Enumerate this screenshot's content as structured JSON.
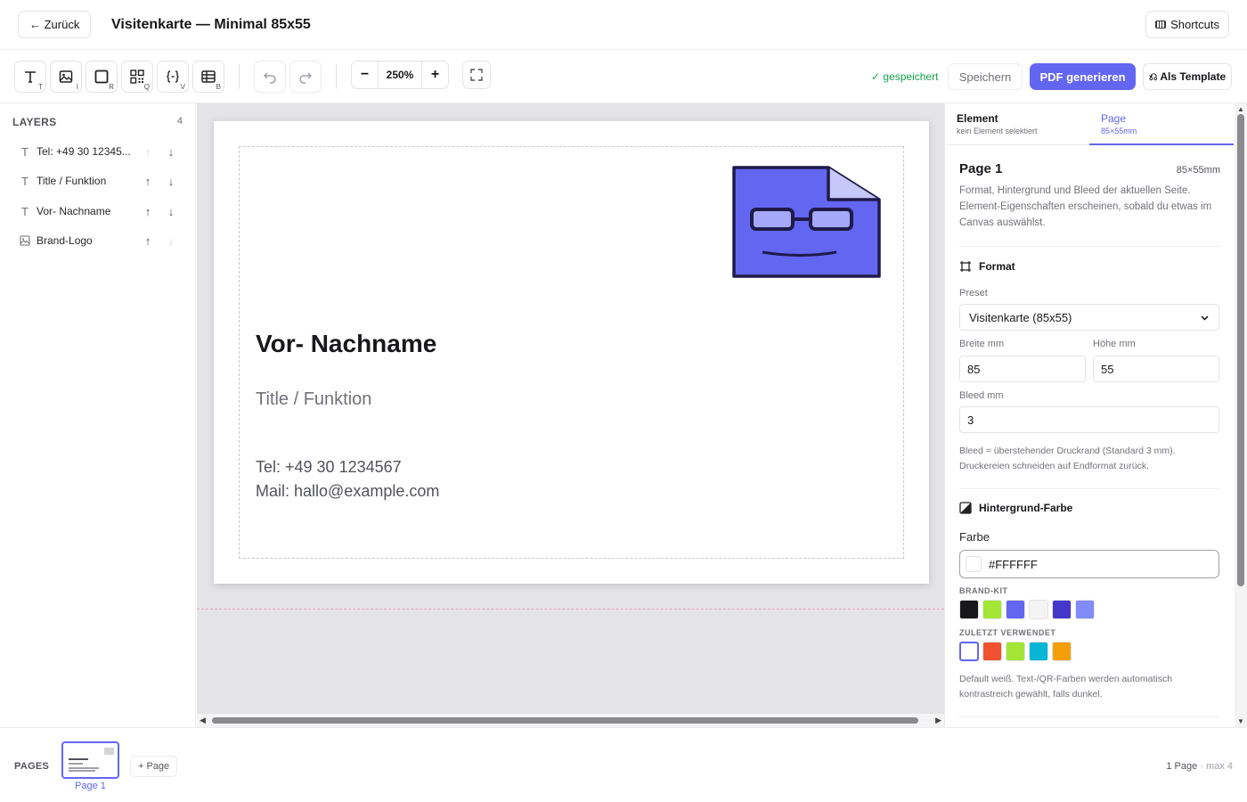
{
  "header": {
    "back_label": "← Zurück",
    "title": "Visitenkarte — Minimal 85x55",
    "shortcuts_label": "Shortcuts"
  },
  "toolbar": {
    "tools": [
      {
        "name": "text-tool",
        "key": "T"
      },
      {
        "name": "image-tool",
        "key": "I"
      },
      {
        "name": "rect-tool",
        "key": "R"
      },
      {
        "name": "qr-tool",
        "key": "Q"
      },
      {
        "name": "variable-tool",
        "key": "V"
      },
      {
        "name": "table-tool",
        "key": "B"
      }
    ],
    "zoom": "250%",
    "zoom_out": "−",
    "zoom_in": "+",
    "saved_status": "✓ gespeichert",
    "save_label": "Speichern",
    "pdf_label": "PDF generieren",
    "template_label": "⎌ Als Template"
  },
  "layers": {
    "heading": "LAYERS",
    "count": "4",
    "items": [
      {
        "label": "Tel: +49 30 12345...",
        "icon": "text-icon",
        "up": "↑",
        "down": "↓",
        "up_disabled": true,
        "down_disabled": false
      },
      {
        "label": "Title / Funktion",
        "icon": "text-icon",
        "up": "↑",
        "down": "↓",
        "up_disabled": false,
        "down_disabled": false
      },
      {
        "label": "Vor- Nachname",
        "icon": "text-icon",
        "up": "↑",
        "down": "↓",
        "up_disabled": false,
        "down_disabled": false
      },
      {
        "label": "Brand-Logo",
        "icon": "image-icon",
        "up": "↑",
        "down": "↓",
        "up_disabled": false,
        "down_disabled": true
      }
    ]
  },
  "card": {
    "name": "Vor- Nachname",
    "title": "Title / Funktion",
    "tel": "Tel: +49 30 1234567",
    "mail": "Mail: hallo@example.com",
    "logo_color": "#6366F1"
  },
  "panel": {
    "tabs": [
      {
        "label": "Element",
        "sub": "kein Element selektiert"
      },
      {
        "label": "Page",
        "sub": "85×55mm"
      }
    ],
    "page_title": "Page 1",
    "page_size": "85×55mm",
    "description": "Format, Hintergrund und Bleed der aktuellen Seite. Element-Eigenschaften erscheinen, sobald du etwas im Canvas auswählst.",
    "format_heading": "Format",
    "preset_label": "Preset",
    "preset_value": "Visitenkarte (85x55)",
    "width_label": "Breite mm",
    "width_value": "85",
    "height_label": "Höhe mm",
    "height_value": "55",
    "bleed_label": "Bleed mm",
    "bleed_value": "3",
    "bleed_hint": "Bleed = überstehender Druckrand (Standard 3 mm). Druckereien schneiden auf Endformat zurück.",
    "bg_heading": "Hintergrund-Farbe",
    "color_label": "Farbe",
    "color_value": "#FFFFFF",
    "brand_kit_label": "BRAND-KIT",
    "brand_kit": [
      "#18181B",
      "#A3E635",
      "#6366F1",
      "#F4F4F5",
      "#4338CA",
      "#818CF8"
    ],
    "recent_label": "ZULETZT VERWENDET",
    "recent": [
      "#FFFFFF",
      "#F0522F",
      "#A3E635",
      "#06B6D4",
      "#F59E0B"
    ],
    "color_hint": "Default weiß. Text-/QR-Farben werden automatisch kontrastreich gewählt, falls dunkel."
  },
  "pages": {
    "label": "PAGES",
    "page_name": "Page 1",
    "add_label": "+ Page",
    "count_text": "1 Page",
    "max_text": "· max 4"
  },
  "colors": {
    "accent": "#6366F1",
    "saved_green": "#16A34A"
  }
}
